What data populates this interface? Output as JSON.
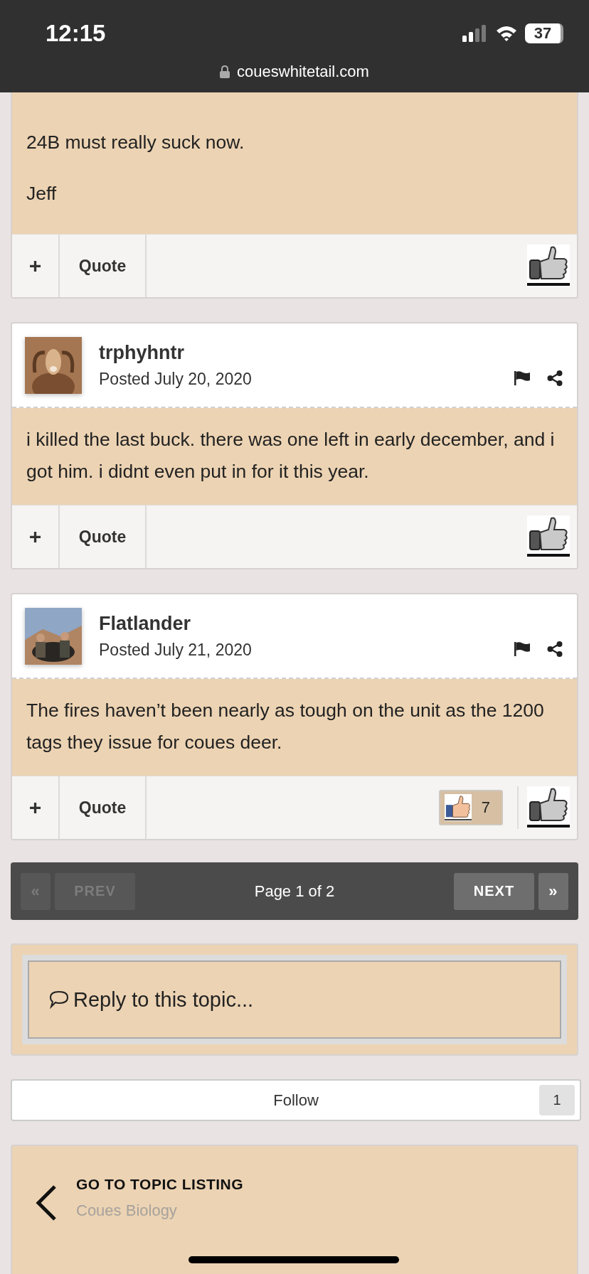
{
  "status_bar": {
    "time": "12:15",
    "battery": "37"
  },
  "address_bar": {
    "url": "coueswhitetail.com"
  },
  "posts": [
    {
      "paragraphs": [
        "24B must really suck now.",
        "Jeff"
      ],
      "actions": [
        "+",
        "Quote"
      ]
    },
    {
      "author": "trphyhntr",
      "posted": "Posted July 20, 2020",
      "avatar": {
        "kind": "picture"
      },
      "paragraphs": [
        "i killed the last buck. there was one left in early december, and i got him. i didnt even put in for it this year."
      ],
      "actions": [
        "+",
        "Quote"
      ]
    },
    {
      "author": "Flatlander",
      "posted": "Posted July 21, 2020",
      "avatar": {
        "kind": "picture"
      },
      "paragraphs": [
        "The fires haven’t been nearly as tough on the unit as the 1200 tags they issue for coues deer."
      ],
      "actions": [
        "+",
        "Quote"
      ],
      "reaction_count": "7"
    }
  ],
  "pagination": {
    "buttons": [
      {
        "label": "«",
        "kind": "icon",
        "disabled": true
      },
      {
        "label": "PREV",
        "kind": "text",
        "disabled": true
      },
      {
        "label": "NEXT",
        "kind": "text",
        "disabled": false
      },
      {
        "label": "»",
        "kind": "icon",
        "disabled": false
      }
    ],
    "page_label": "Page 1 of 2"
  },
  "reply": {
    "placeholder": "Reply to this topic..."
  },
  "follow": {
    "label": "Follow",
    "count": "1"
  },
  "topic_nav": {
    "title": "GO TO TOPIC LISTING",
    "subtitle": "Coues Biology"
  }
}
